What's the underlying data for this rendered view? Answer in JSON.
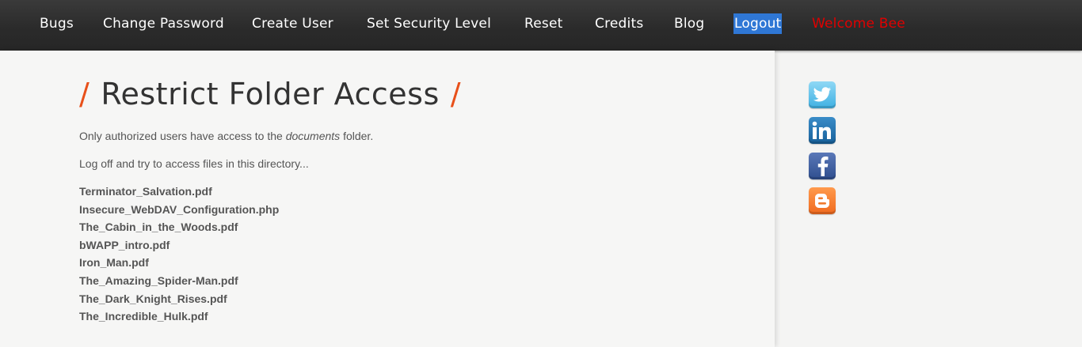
{
  "nav": {
    "items": [
      {
        "label": "Bugs"
      },
      {
        "label": "Change Password"
      },
      {
        "label": "Create User"
      },
      {
        "label": "Set Security Level"
      },
      {
        "label": "Reset"
      },
      {
        "label": "Credits"
      },
      {
        "label": "Blog"
      },
      {
        "label": "Logout"
      }
    ],
    "welcome": "Welcome Bee"
  },
  "main": {
    "title": "Restrict Folder Access",
    "title_slash": "/",
    "intro_prefix": "Only authorized users have access to the ",
    "intro_emph": "documents",
    "intro_suffix": " folder.",
    "instruction": "Log off and try to access files in this directory...",
    "files": [
      "Terminator_Salvation.pdf",
      "Insecure_WebDAV_Configuration.php",
      "The_Cabin_in_the_Woods.pdf",
      "bWAPP_intro.pdf",
      "Iron_Man.pdf",
      "The_Amazing_Spider-Man.pdf",
      "The_Dark_Knight_Rises.pdf",
      "The_Incredible_Hulk.pdf"
    ]
  },
  "social": [
    {
      "name": "twitter-icon",
      "color": "#5bc0e8"
    },
    {
      "name": "linkedin-icon",
      "color": "#1f6fa8"
    },
    {
      "name": "facebook-icon",
      "color": "#3b5b9e"
    },
    {
      "name": "blogger-icon",
      "color": "#f26c22"
    }
  ],
  "colors": {
    "accent_slash": "#e8501a",
    "welcome": "#e00000",
    "active_nav": "#2f77d5"
  }
}
